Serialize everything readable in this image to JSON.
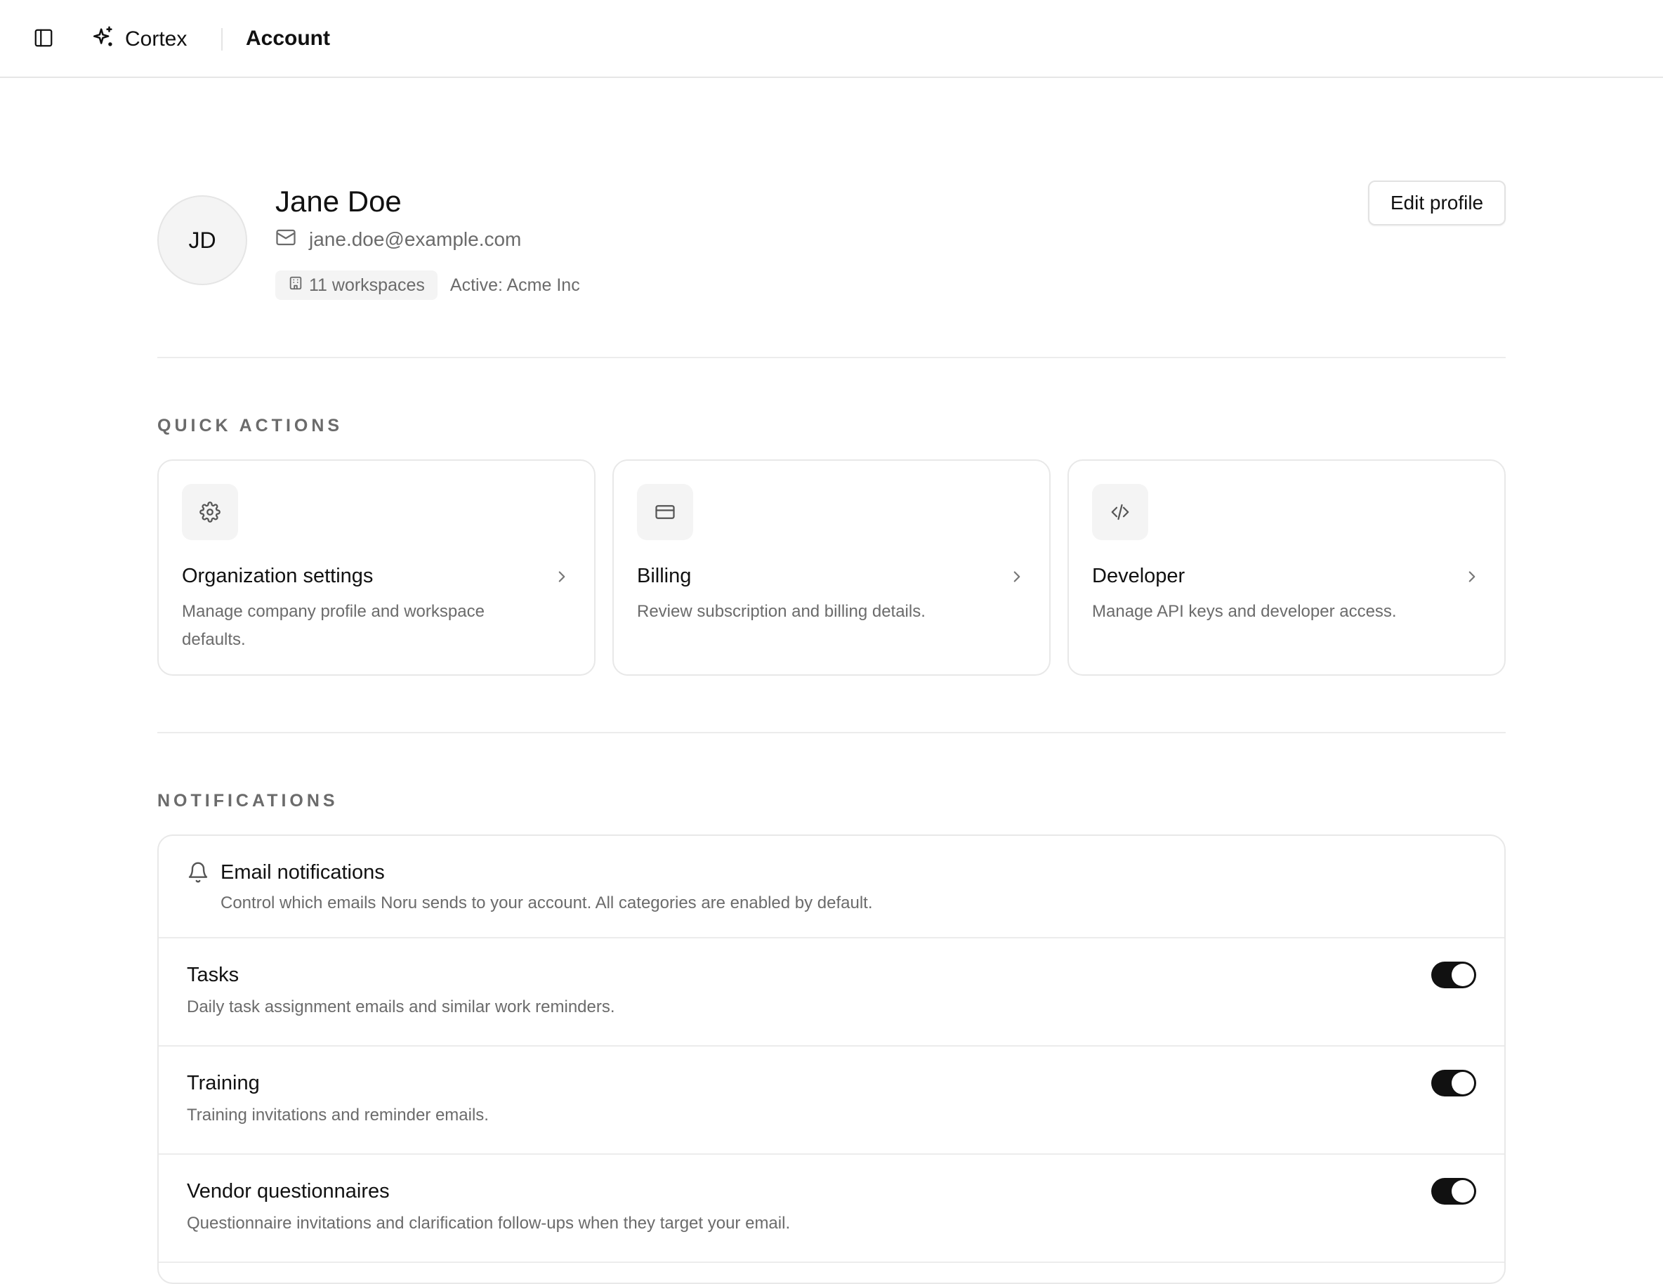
{
  "topbar": {
    "toggle_icon": "sidebar-toggle-icon",
    "brand": "Cortex",
    "brand_icon": "sparkles-icon",
    "page_title": "Account"
  },
  "profile": {
    "initials": "JD",
    "name": "Jane Doe",
    "email": "jane.doe@example.com",
    "workspaces": "11 workspaces",
    "active": "Active: Acme Inc",
    "edit_label": "Edit profile"
  },
  "quick_actions": {
    "title": "QUICK ACTIONS",
    "cards": [
      {
        "icon": "gear-icon",
        "title": "Organization settings",
        "desc": "Manage company profile and workspace defaults."
      },
      {
        "icon": "credit-card-icon",
        "title": "Billing",
        "desc": "Review subscription and billing details."
      },
      {
        "icon": "code-icon",
        "title": "Developer",
        "desc": "Manage API keys and developer access."
      }
    ]
  },
  "notifications": {
    "title": "NOTIFICATIONS",
    "header_title": "Email notifications",
    "header_desc": "Control which emails Noru sends to your account. All categories are enabled by default.",
    "rows": [
      {
        "title": "Tasks",
        "desc": "Daily task assignment emails and similar work reminders.",
        "enabled": true
      },
      {
        "title": "Training",
        "desc": "Training invitations and reminder emails.",
        "enabled": true
      },
      {
        "title": "Vendor questionnaires",
        "desc": "Questionnaire invitations and clarification follow-ups when they target your email.",
        "enabled": true
      }
    ]
  },
  "colors": {
    "text": "#111111",
    "muted": "#6b6b6b",
    "border": "#e8e8e8",
    "toggle_on": "#111111"
  }
}
